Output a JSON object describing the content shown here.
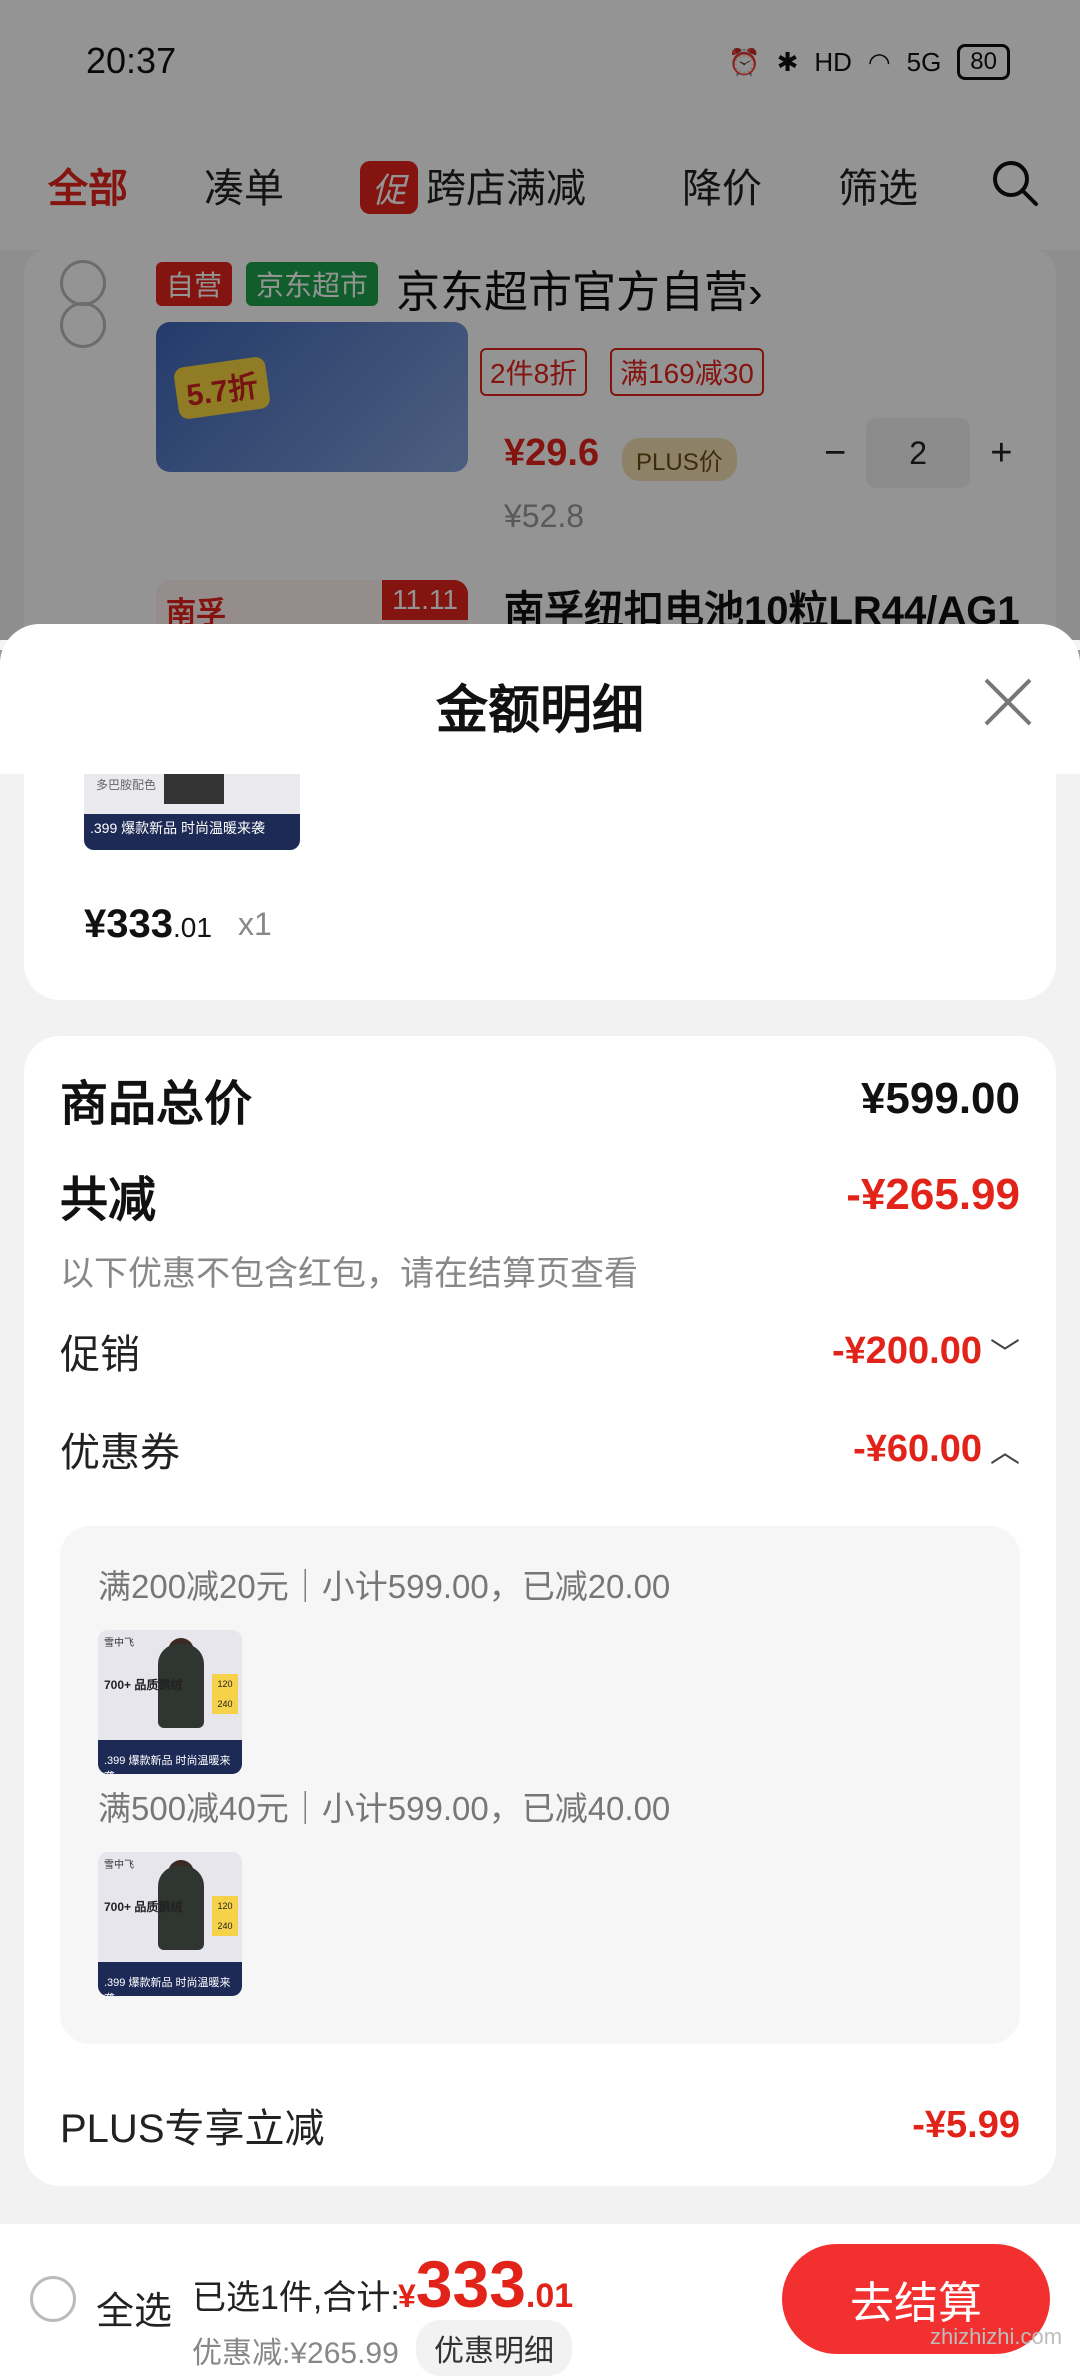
{
  "status_bar": {
    "time": "20:37",
    "network": "5G",
    "hd": "HD",
    "battery": "80"
  },
  "top_tabs": {
    "all": "全部",
    "bundle": "凑单",
    "promo_badge": "促",
    "cross_store": "跨店满减",
    "price_drop": "降价",
    "filter": "筛选"
  },
  "background_cart": {
    "tag_self": "自营",
    "tag_market": "京东超市",
    "shop_name": "京东超市官方自营",
    "shop_arrow": "›",
    "product1": {
      "discount_badge": "5.7折",
      "promo_tags": [
        "2件8折",
        "满169减30"
      ],
      "price": "¥29.6",
      "plus_tag": "PLUS价",
      "quantity": "2",
      "minus": "−",
      "plus": "+",
      "old_price": "¥52.8"
    },
    "product2": {
      "brand": "南孚",
      "badge": "11.11",
      "title": "南孚纽扣电池10粒LR44/AG1"
    }
  },
  "sheet": {
    "title": "金额明细",
    "item": {
      "thumb_label": "多巴胺配色",
      "thumb_price": ".399",
      "thumb_band": "爆款新品 时尚温暖来袭",
      "price_main": "¥333",
      "price_decimal": ".01",
      "quantity": "x1"
    },
    "summary": {
      "total_label": "商品总价",
      "total_value": "¥599.00",
      "reduce_label": "共减",
      "reduce_value": "-¥265.99",
      "note": "以下优惠不包含红包，请在结算页查看",
      "promo_label": "促销",
      "promo_value": "-¥200.00",
      "promo_chevron": "﹀",
      "coupon_label": "优惠券",
      "coupon_value": "-¥60.00",
      "coupon_chevron": "︿",
      "coupons": [
        {
          "text": "满200减20元｜小计599.00，已减20.00"
        },
        {
          "text": "满500减40元｜小计599.00，已减40.00"
        }
      ],
      "coupon_thumb": {
        "brand": "雪中飞",
        "headline": "700+ 品质鹅绒",
        "price": ".399",
        "band": "爆款新品 时尚温暖来袭",
        "tag_top": "120",
        "tag_bottom": "240"
      },
      "plus_label": "PLUS专享立减",
      "plus_value": "-¥5.99"
    }
  },
  "checkout": {
    "select_all": "全选",
    "selected_count": "已选1件,合计:",
    "total_yen": "¥",
    "total_int": "333",
    "total_dec": ".01",
    "discount_line": "优惠减:¥265.99",
    "detail_button": "优惠明细",
    "checkout_button": "去结算",
    "watermark": "zhizhizhi.com"
  },
  "colors": {
    "accent": "#e2231a",
    "market_green": "#1aa34a"
  }
}
